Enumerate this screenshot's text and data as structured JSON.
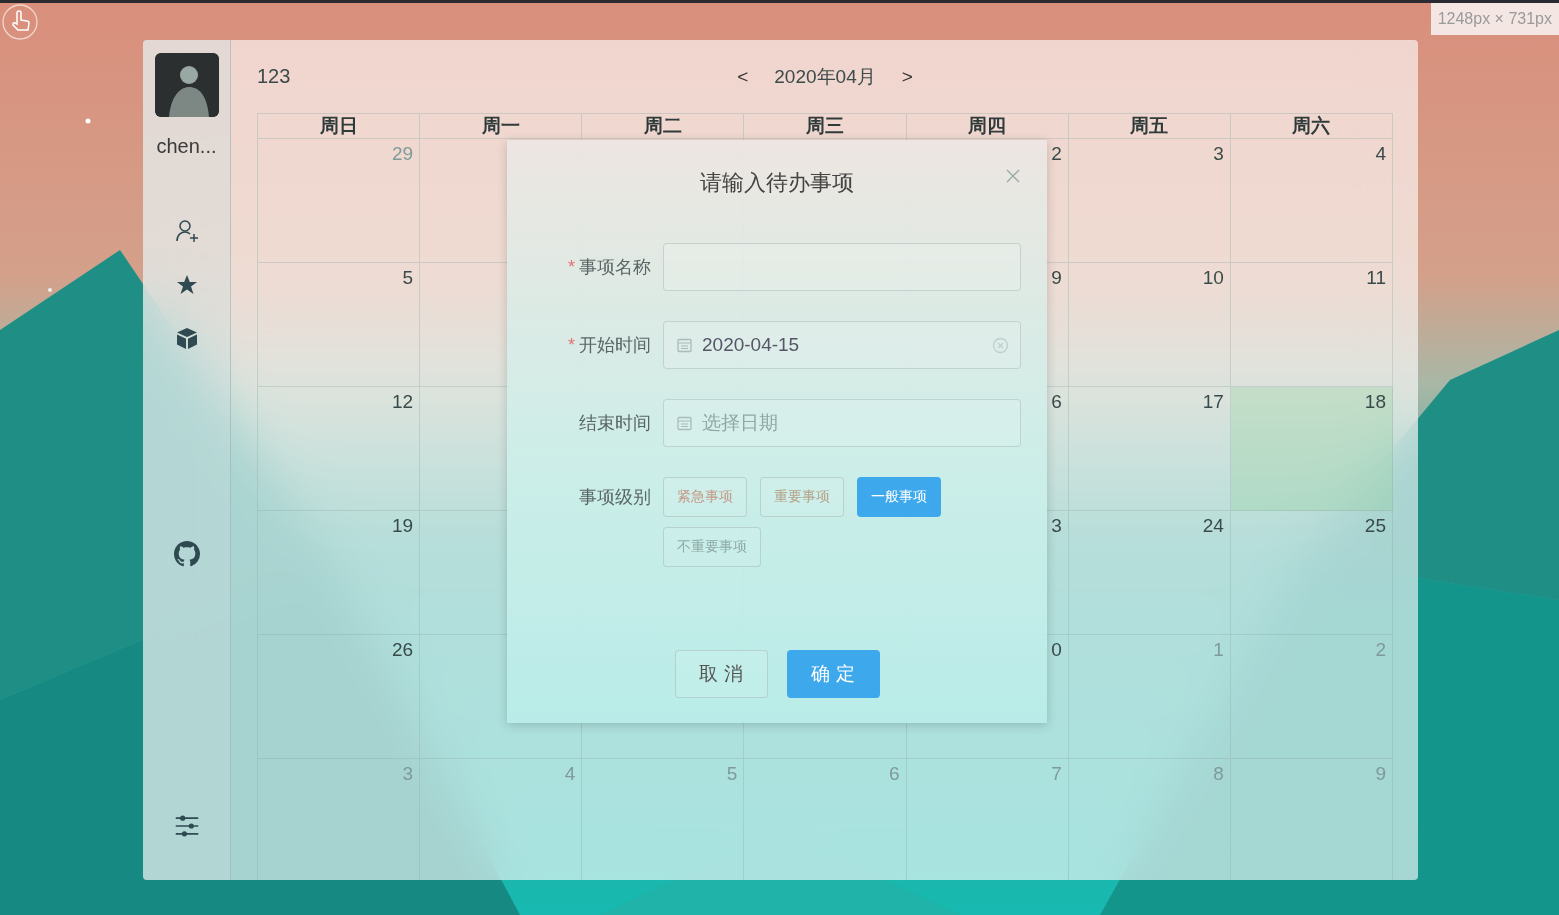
{
  "size_badge": "1248px × 731px",
  "user": {
    "name": "chen..."
  },
  "header": {
    "title": "123",
    "prev": "<",
    "month": "2020年04月",
    "next": ">"
  },
  "calendar": {
    "weekdays": [
      "周日",
      "周一",
      "周二",
      "周三",
      "周四",
      "周五",
      "周六"
    ],
    "weeks": [
      {
        "left": [
          {
            "day": "29",
            "muted": true,
            "today": false
          }
        ],
        "right": [
          {
            "day": "2",
            "muted": false,
            "today": false
          },
          {
            "day": "3",
            "muted": false,
            "today": false
          },
          {
            "day": "4",
            "muted": false,
            "today": false
          }
        ]
      },
      {
        "left": [
          {
            "day": "5",
            "muted": false,
            "today": false
          }
        ],
        "right": [
          {
            "day": "9",
            "muted": false,
            "today": false
          },
          {
            "day": "10",
            "muted": false,
            "today": false
          },
          {
            "day": "11",
            "muted": false,
            "today": false
          }
        ]
      },
      {
        "left": [
          {
            "day": "12",
            "muted": false,
            "today": false
          }
        ],
        "right": [
          {
            "day": "6",
            "muted": false,
            "today": false
          },
          {
            "day": "17",
            "muted": false,
            "today": false
          },
          {
            "day": "18",
            "muted": false,
            "today": true
          }
        ]
      },
      {
        "left": [
          {
            "day": "19",
            "muted": false,
            "today": false
          }
        ],
        "right": [
          {
            "day": "3",
            "muted": false,
            "today": false
          },
          {
            "day": "24",
            "muted": false,
            "today": false
          },
          {
            "day": "25",
            "muted": false,
            "today": false
          }
        ]
      },
      {
        "left": [
          {
            "day": "26",
            "muted": false,
            "today": false
          }
        ],
        "right": [
          {
            "day": "0",
            "muted": false,
            "today": false
          },
          {
            "day": "1",
            "muted": true,
            "today": false
          },
          {
            "day": "2",
            "muted": true,
            "today": false
          }
        ]
      },
      {
        "left": [
          {
            "day": "3",
            "muted": true,
            "today": false
          },
          {
            "day": "4",
            "muted": true,
            "today": false
          },
          {
            "day": "5",
            "muted": true,
            "today": false
          },
          {
            "day": "6",
            "muted": true,
            "today": false
          },
          {
            "day": "7",
            "muted": true,
            "today": false
          },
          {
            "day": "8",
            "muted": true,
            "today": false
          },
          {
            "day": "9",
            "muted": true,
            "today": false
          }
        ]
      }
    ]
  },
  "dialog": {
    "title": "请输入待办事项",
    "fields": [
      {
        "kind": "text",
        "label": "事项名称",
        "required_mark": "*"
      },
      {
        "kind": "date",
        "label": "开始时间",
        "required_mark": "*",
        "value": "2020-04-15"
      },
      {
        "kind": "date",
        "label": "结束时间",
        "placeholder": "选择日期"
      }
    ],
    "level": {
      "label": "事项级别",
      "options": [
        {
          "label": "紧急事项",
          "color": "#c49a88",
          "selected": false
        },
        {
          "label": "重要事项",
          "color": "#b4a288",
          "selected": false
        },
        {
          "label": "一般事项",
          "color": "#3ea8ec",
          "selected": true
        },
        {
          "label": "不重要事项",
          "color": "#8eaaa6",
          "selected": false
        }
      ]
    },
    "buttons": [
      {
        "label": "取 消",
        "kind": "default"
      },
      {
        "label": "确 定",
        "kind": "primary"
      }
    ]
  }
}
